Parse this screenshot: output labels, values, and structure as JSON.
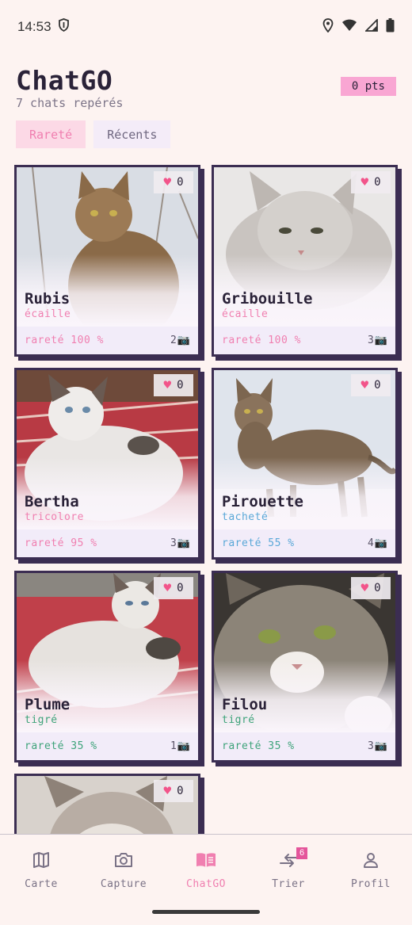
{
  "status": {
    "time": "14:53"
  },
  "header": {
    "title": "ChatGO",
    "subtitle": "7 chats repérés",
    "points": "0 pts"
  },
  "sort": {
    "rarity_label": "Rareté",
    "recent_label": "Récents",
    "active": "Rareté"
  },
  "cats": [
    {
      "name": "Rubis",
      "type": "écaille",
      "type_color": "#f07fb0",
      "rarity": "rareté 100 %",
      "photos": "2",
      "likes": "0",
      "fur": "#8a6a48"
    },
    {
      "name": "Gribouille",
      "type": "écaille",
      "type_color": "#f07fb0",
      "rarity": "rareté 100 %",
      "photos": "3",
      "likes": "0",
      "fur": "#c9c4c0"
    },
    {
      "name": "Bertha",
      "type": "tricolore",
      "type_color": "#f07fb0",
      "rarity": "rareté 95 %",
      "photos": "3",
      "likes": "0",
      "fur": "#e9e6e4"
    },
    {
      "name": "Pirouette",
      "type": "tacheté",
      "type_color": "#5aa8d8",
      "rarity": "rareté 55 %",
      "photos": "4",
      "likes": "0",
      "fur": "#7c6650"
    },
    {
      "name": "Plume",
      "type": "tigré",
      "type_color": "#3ea37a",
      "rarity": "rareté 35 %",
      "photos": "1",
      "likes": "0",
      "fur": "#e6e2de"
    },
    {
      "name": "Filou",
      "type": "tigré",
      "type_color": "#3ea37a",
      "rarity": "rareté 35 %",
      "photos": "3",
      "likes": "0",
      "fur": "#8c8478"
    },
    {
      "name": "",
      "type": "",
      "type_color": "#f07fb0",
      "rarity": "",
      "photos": "",
      "likes": "0",
      "fur": "#b8ada4"
    }
  ],
  "nav": {
    "map_label": "Carte",
    "capture_label": "Capture",
    "chatgo_label": "ChatGO",
    "sort_label": "Trier",
    "sort_badge": "6",
    "profile_label": "Profil"
  },
  "icons": [
    "shield-icon",
    "location-icon",
    "wifi-icon",
    "signal-icon",
    "battery-icon",
    "heart-icon",
    "camera-icon",
    "map-icon",
    "book-icon",
    "swap-icon",
    "person-icon"
  ],
  "colors": {
    "accent": "#f07fb0",
    "card_border": "#3b2d52",
    "points_bg": "#f9a6d3"
  }
}
